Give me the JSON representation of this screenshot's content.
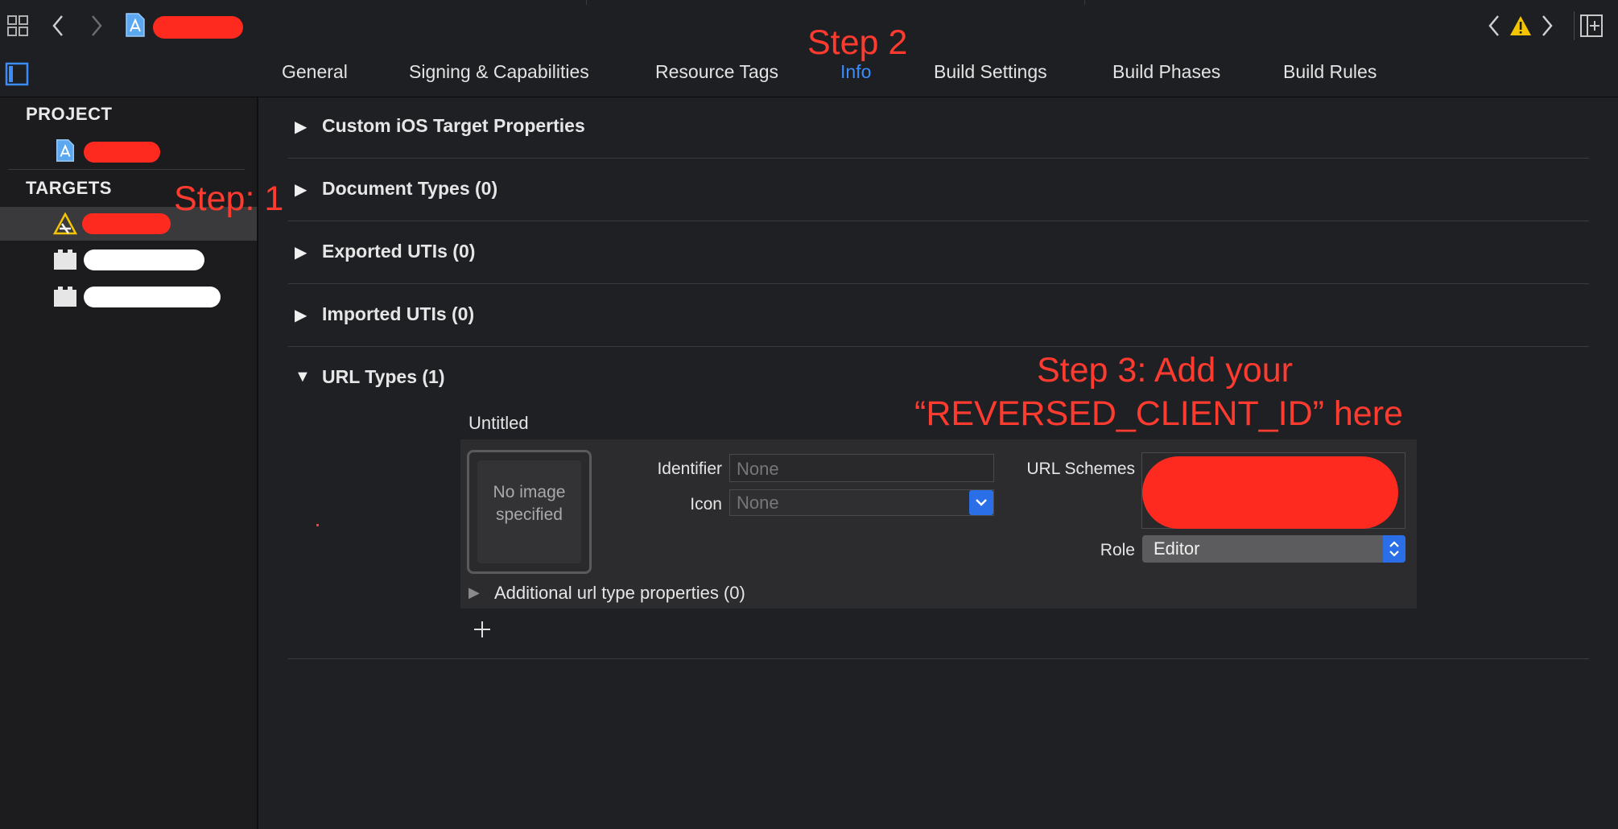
{
  "tabs": [
    "General",
    "Signing & Capabilities",
    "Resource Tags",
    "Info",
    "Build Settings",
    "Build Phases",
    "Build Rules"
  ],
  "active_tab": "Info",
  "sidebar": {
    "project_header": "PROJECT",
    "targets_header": "TARGETS"
  },
  "sections": [
    {
      "title": "Custom iOS Target Properties",
      "expanded": false
    },
    {
      "title": "Document Types (0)",
      "expanded": false
    },
    {
      "title": "Exported UTIs (0)",
      "expanded": false
    },
    {
      "title": "Imported UTIs (0)",
      "expanded": false
    },
    {
      "title": "URL Types (1)",
      "expanded": true
    }
  ],
  "url_type": {
    "name": "Untitled",
    "image_placeholder": "No image specified",
    "identifier_label": "Identifier",
    "identifier_placeholder": "None",
    "icon_label": "Icon",
    "icon_value": "None",
    "url_schemes_label": "URL Schemes",
    "role_label": "Role",
    "role_value": "Editor",
    "additional": "Additional url type properties (0)"
  },
  "annotations": {
    "step1": "Step: 1",
    "step2": "Step 2",
    "step3_line1": "Step 3: Add your",
    "step3_line2": "“REVERSED_CLIENT_ID” here"
  },
  "colors": {
    "accent": "#3a8dfb",
    "annotation": "#ff3b30",
    "warning": "#f5c400"
  },
  "icons": [
    "grid-icon",
    "back-chevron-icon",
    "forward-chevron-icon",
    "file-icon",
    "warning-icon",
    "split-editor-icon",
    "sidebar-toggle-icon",
    "app-target-icon",
    "framework-icon"
  ]
}
